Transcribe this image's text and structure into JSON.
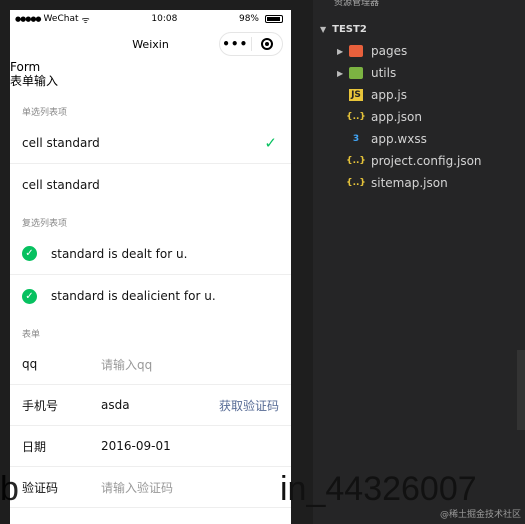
{
  "statusbar": {
    "signal": "●●●●●",
    "carrier": "WeChat",
    "wifi": "ᯤ",
    "time": "10:08",
    "battery": "98%"
  },
  "navbar": {
    "title": "Weixin",
    "more": "•••"
  },
  "page": {
    "title": "Form",
    "desc": "表单输入"
  },
  "radio_section": {
    "title": "单选列表项",
    "items": [
      {
        "label": "cell standard",
        "checked": true
      },
      {
        "label": "cell standard",
        "checked": false
      }
    ]
  },
  "checkbox_section": {
    "title": "复选列表项",
    "items": [
      {
        "label": "standard is dealt for u."
      },
      {
        "label": "standard is dealicient for u."
      }
    ]
  },
  "form_section": {
    "title": "表单",
    "rows": [
      {
        "label": "qq",
        "placeholder": "请输入qq"
      },
      {
        "label": "手机号",
        "value": "asda",
        "action": "获取验证码"
      },
      {
        "label": "日期",
        "value": "2016-09-01"
      },
      {
        "label": "验证码",
        "placeholder": "请输入验证码"
      }
    ]
  },
  "watermark": {
    "left": "b",
    "right": "in_44326007"
  },
  "explorer": {
    "header": "资源管理器",
    "project": "TEST2",
    "items": [
      {
        "name": "pages",
        "kind": "folder"
      },
      {
        "name": "utils",
        "kind": "folder"
      },
      {
        "name": "app.js",
        "kind": "js"
      },
      {
        "name": "app.json",
        "kind": "json"
      },
      {
        "name": "app.wxss",
        "kind": "css"
      },
      {
        "name": "project.config.json",
        "kind": "json"
      },
      {
        "name": "sitemap.json",
        "kind": "json"
      }
    ],
    "corner_note": "@稀土掘金技术社区"
  },
  "colors": {
    "accent": "#07c160",
    "link": "#576b95",
    "explorer_bg": "#252526"
  }
}
